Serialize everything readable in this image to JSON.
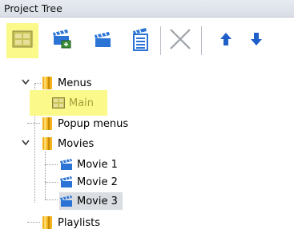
{
  "panel": {
    "title": "Project Tree"
  },
  "toolbar": {
    "buttons": [
      {
        "name": "add-menu-button",
        "icon": "menu-grid-icon",
        "highlighted": true
      },
      {
        "name": "add-movie-button",
        "icon": "clapperboard-add-icon"
      },
      {
        "name": "movie-button",
        "icon": "clapperboard-icon"
      },
      {
        "name": "playlist-button",
        "icon": "clapperboard-list-icon"
      },
      {
        "name": "delete-button",
        "icon": "close-icon"
      },
      {
        "name": "move-up-button",
        "icon": "arrow-up-icon"
      },
      {
        "name": "move-down-button",
        "icon": "arrow-down-icon"
      }
    ]
  },
  "tree": {
    "menus": {
      "label": "Menus",
      "expanded": true,
      "children": [
        {
          "label": "Main",
          "highlighted": true
        }
      ]
    },
    "popup_menus": {
      "label": "Popup menus"
    },
    "movies": {
      "label": "Movies",
      "expanded": true,
      "children": [
        {
          "label": "Movie 1"
        },
        {
          "label": "Movie 2"
        },
        {
          "label": "Movie 3",
          "selected": true
        }
      ]
    },
    "playlists": {
      "label": "Playlists"
    }
  },
  "colors": {
    "highlight": "#fbf98a",
    "selection": "#dadde2",
    "folder": "#f3b21b",
    "clapper": "#2b74d6",
    "arrow": "#1f5fc9"
  }
}
